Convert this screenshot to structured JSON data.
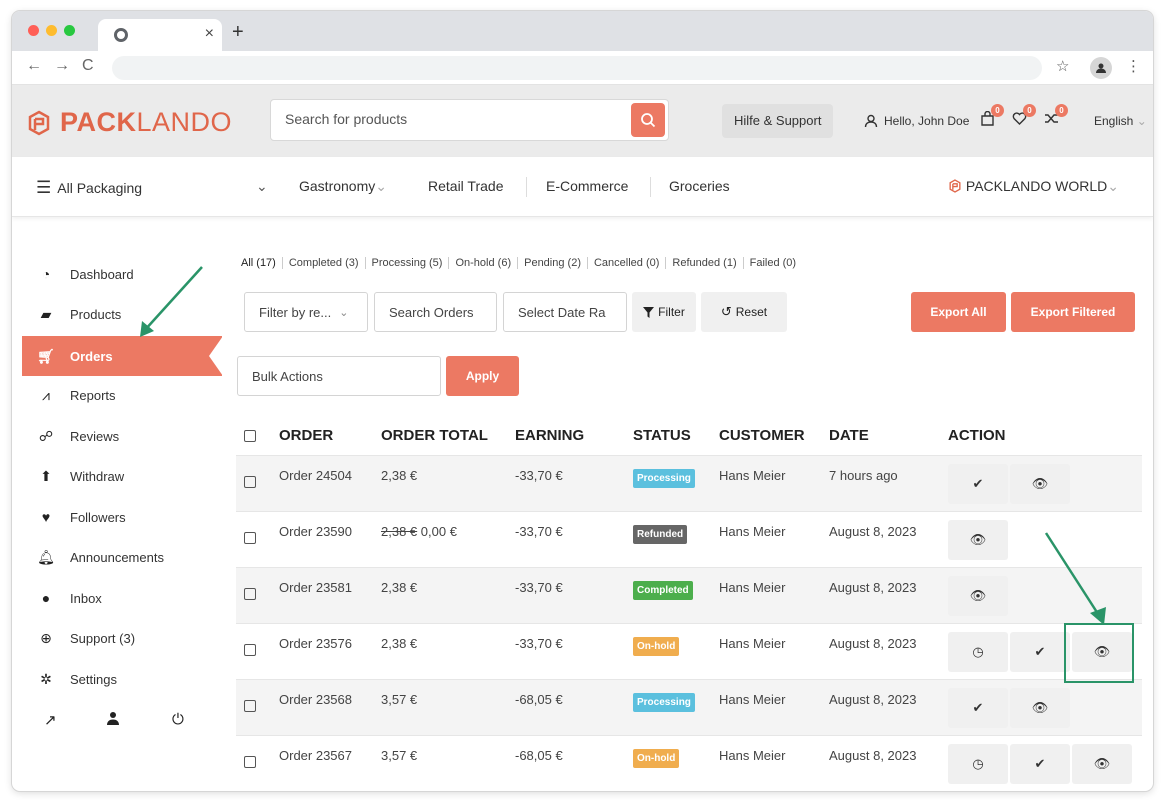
{
  "browser": {
    "tab_close": "×",
    "new_tab": "+",
    "back": "←",
    "forward": "→",
    "reload": "C",
    "star": "☆",
    "menu": "⋮",
    "dot_colors": [
      "#ff5f57",
      "#febc2e",
      "#28c840"
    ]
  },
  "header": {
    "logo_bold": "PACK",
    "logo_thin": "LANDO",
    "search_placeholder": "Search for products",
    "help_label": "Hilfe & Support",
    "hello": "Hello, John Doe",
    "cart_count": "0",
    "wishlist_count": "0",
    "compare_count": "0",
    "language": "English"
  },
  "catnav": {
    "all_packaging": "All Packaging",
    "items": [
      "Gastronomy",
      "Retail Trade",
      "E-Commerce",
      "Groceries"
    ],
    "world": "PACKLANDO WORLD"
  },
  "sidebar": {
    "items": [
      {
        "label": "Dashboard",
        "icon": "dashboard-icon"
      },
      {
        "label": "Products",
        "icon": "briefcase-icon"
      },
      {
        "label": "Orders",
        "icon": "cart-icon"
      },
      {
        "label": "Reports",
        "icon": "chart-icon"
      },
      {
        "label": "Reviews",
        "icon": "comments-icon"
      },
      {
        "label": "Withdraw",
        "icon": "upload-icon"
      },
      {
        "label": "Followers",
        "icon": "heart-icon"
      },
      {
        "label": "Announcements",
        "icon": "bell-icon"
      },
      {
        "label": "Inbox",
        "icon": "chat-icon"
      },
      {
        "label": "Support (3)",
        "icon": "lifebuoy-icon"
      },
      {
        "label": "Settings",
        "icon": "gear-icon"
      }
    ]
  },
  "filters": [
    "All (17)",
    "Completed (3)",
    "Processing (5)",
    "On-hold (6)",
    "Pending (2)",
    "Cancelled (0)",
    "Refunded (1)",
    "Failed (0)"
  ],
  "toolbar": {
    "filter_by": "Filter by re...",
    "search_orders": "Search Orders",
    "select_date": "Select Date Ra",
    "filter_btn": "Filter",
    "reset_btn": "Reset",
    "export_all": "Export All",
    "export_filtered": "Export Filtered",
    "bulk_actions": "Bulk Actions",
    "apply": "Apply"
  },
  "table": {
    "headers": [
      "ORDER",
      "ORDER TOTAL",
      "EARNING",
      "STATUS",
      "CUSTOMER",
      "DATE",
      "ACTION"
    ],
    "rows": [
      {
        "order": "Order 24504",
        "total": "2,38 €",
        "total_old": "",
        "earning": "-33,70 €",
        "status": "Processing",
        "customer": "Hans Meier",
        "date": "7 hours ago"
      },
      {
        "order": "Order 23590",
        "total": "0,00 €",
        "total_old": "2,38 €",
        "earning": "-33,70 €",
        "status": "Refunded",
        "customer": "Hans Meier",
        "date": "August 8, 2023"
      },
      {
        "order": "Order 23581",
        "total": "2,38 €",
        "total_old": "",
        "earning": "-33,70 €",
        "status": "Completed",
        "customer": "Hans Meier",
        "date": "August 8, 2023"
      },
      {
        "order": "Order 23576",
        "total": "2,38 €",
        "total_old": "",
        "earning": "-33,70 €",
        "status": "On-hold",
        "customer": "Hans Meier",
        "date": "August 8, 2023"
      },
      {
        "order": "Order 23568",
        "total": "3,57 €",
        "total_old": "",
        "earning": "-68,05 €",
        "status": "Processing",
        "customer": "Hans Meier",
        "date": "August 8, 2023"
      },
      {
        "order": "Order 23567",
        "total": "3,57 €",
        "total_old": "",
        "earning": "-68,05 €",
        "status": "On-hold",
        "customer": "Hans Meier",
        "date": "August 8, 2023"
      }
    ]
  },
  "colors": {
    "accent": "#ec7963",
    "annotation": "#2a9468",
    "date_red": "#d9333f"
  }
}
